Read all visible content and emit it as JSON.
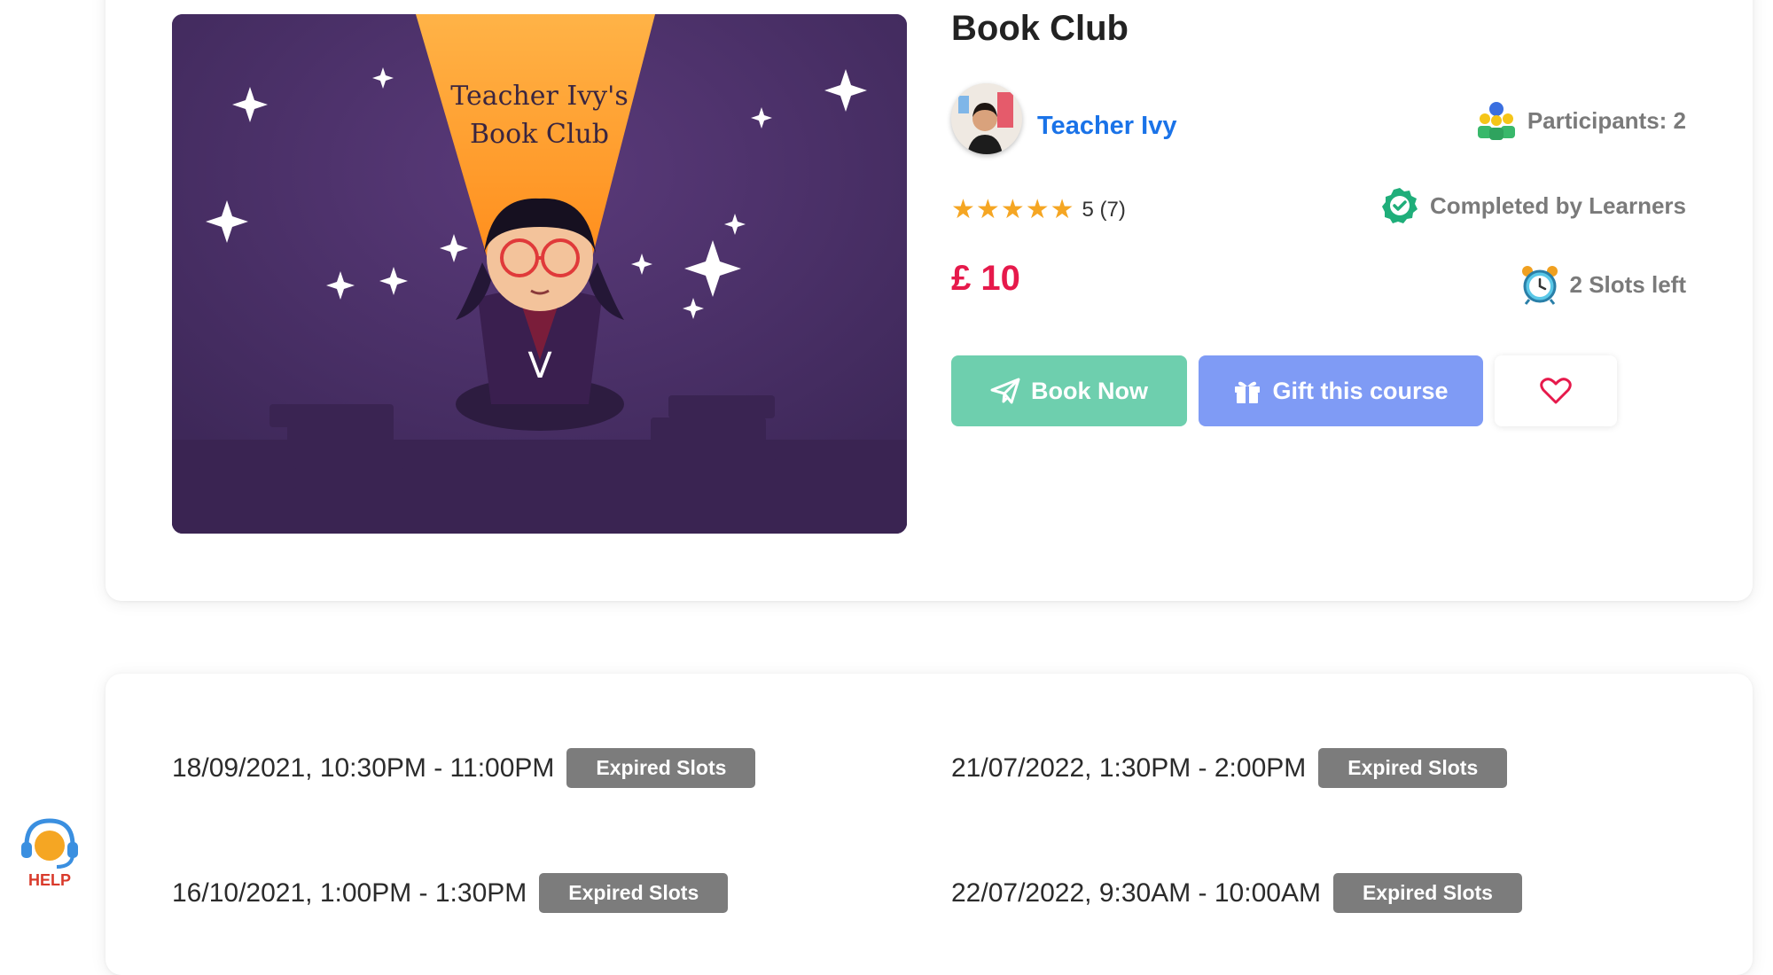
{
  "course": {
    "image_title_line1": "Teacher Ivy's",
    "image_title_line2": "Book Club",
    "title": "Book Club",
    "teacher_name": "Teacher Ivy",
    "rating_value": "5 (7)",
    "rating_stars": 5,
    "price": "£ 10",
    "participants": "Participants: 2",
    "completion": "Completed by Learners",
    "slots_left": "2 Slots left"
  },
  "actions": {
    "book_now": "Book Now",
    "gift": "Gift this course",
    "favorite_icon": "heart-icon"
  },
  "slots": [
    {
      "time": "18/09/2021, 10:30PM - 11:00PM",
      "status": "Expired Slots"
    },
    {
      "time": "21/07/2022, 1:30PM - 2:00PM",
      "status": "Expired Slots"
    },
    {
      "time": "16/10/2021, 1:00PM - 1:30PM",
      "status": "Expired Slots"
    },
    {
      "time": "22/07/2022, 9:30AM - 10:00AM",
      "status": "Expired Slots"
    }
  ],
  "help": {
    "label": "HELP"
  },
  "colors": {
    "price": "#e6194b",
    "teacher_link": "#1a73e8",
    "book_button": "#6ecfae",
    "gift_button": "#7f9bf5",
    "badge": "#7c7c7c",
    "star": "#f5a623"
  }
}
